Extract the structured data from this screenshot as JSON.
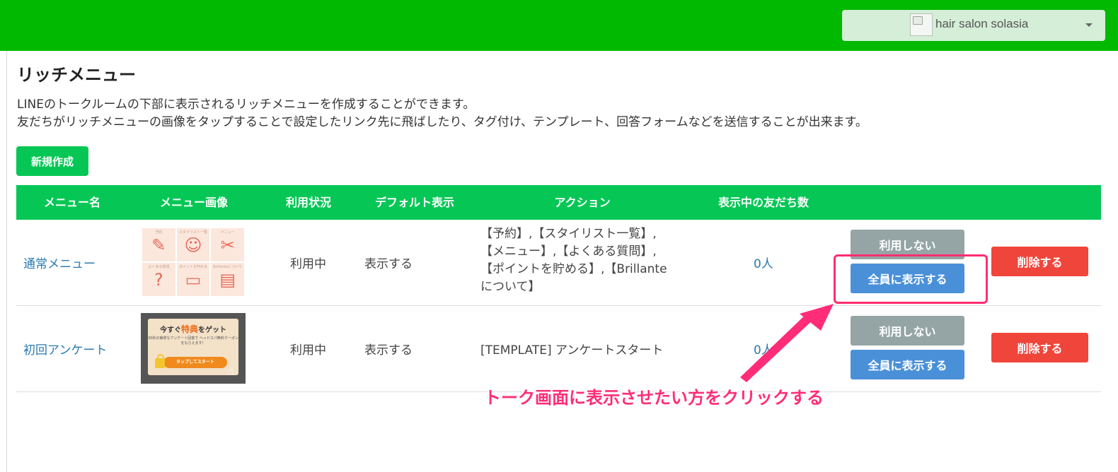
{
  "header": {
    "account_name": "hair salon solasia"
  },
  "page": {
    "title": "リッチメニュー",
    "description_line1": "LINEのトークルームの下部に表示されるリッチメニューを作成することができます。",
    "description_line2": "友だちがリッチメニューの画像をタップすることで設定したリンク先に飛ばしたり、タグ付け、テンプレート、回答フォームなどを送信することが出来ます。",
    "new_button": "新規作成"
  },
  "table": {
    "columns": [
      "メニュー名",
      "メニュー画像",
      "利用状況",
      "デフォルト表示",
      "アクション",
      "表示中の友だち数",
      ""
    ],
    "rows": [
      {
        "name": "通常メニュー",
        "status": "利用中",
        "default_display": "表示する",
        "action_lines": [
          "【予約】,【スタイリスト一覧】,",
          "【メニュー】,【よくある質問】,",
          "【ポイントを貯める】,【Brillante",
          "について】"
        ],
        "friends": "0人",
        "btn_unuse": "利用しない",
        "btn_show_all": "全員に表示する",
        "btn_delete": "削除する",
        "image_tiles": [
          {
            "label": "予約",
            "icon": "✎"
          },
          {
            "label": "スタイリスト一覧",
            "icon": "☺"
          },
          {
            "label": "メニュー",
            "icon": "✂"
          },
          {
            "label": "よくある質問",
            "icon": "?"
          },
          {
            "label": "ポイントを貯める",
            "icon": "▭"
          },
          {
            "label": "Brillanteについて",
            "icon": "▤"
          }
        ]
      },
      {
        "name": "初回アンケート",
        "status": "利用中",
        "default_display": "表示する",
        "action_lines": [
          "[TEMPLATE] アンケートスタート"
        ],
        "friends": "0人",
        "btn_unuse": "利用しない",
        "btn_show_all": "全員に表示する",
        "btn_delete": "削除する",
        "image_text": {
          "head_pre": "今すぐ",
          "head_hl": "特典",
          "head_post": "をゲット",
          "sub": "30秒の簡単なアンケート回答で ヘッドスパ無料クーポンをもらえます！",
          "button": "タップしてスタート"
        }
      }
    ]
  },
  "annotation": {
    "text": "トーク画面に表示させたい方をクリックする",
    "color": "#ff2d78"
  },
  "colors": {
    "header_green": "#00b900",
    "line_green": "#06c755",
    "link_blue": "#2a7ab0",
    "gray_button": "#95a5a6",
    "blue_button": "#4a90d9",
    "red_button": "#f0453a"
  }
}
